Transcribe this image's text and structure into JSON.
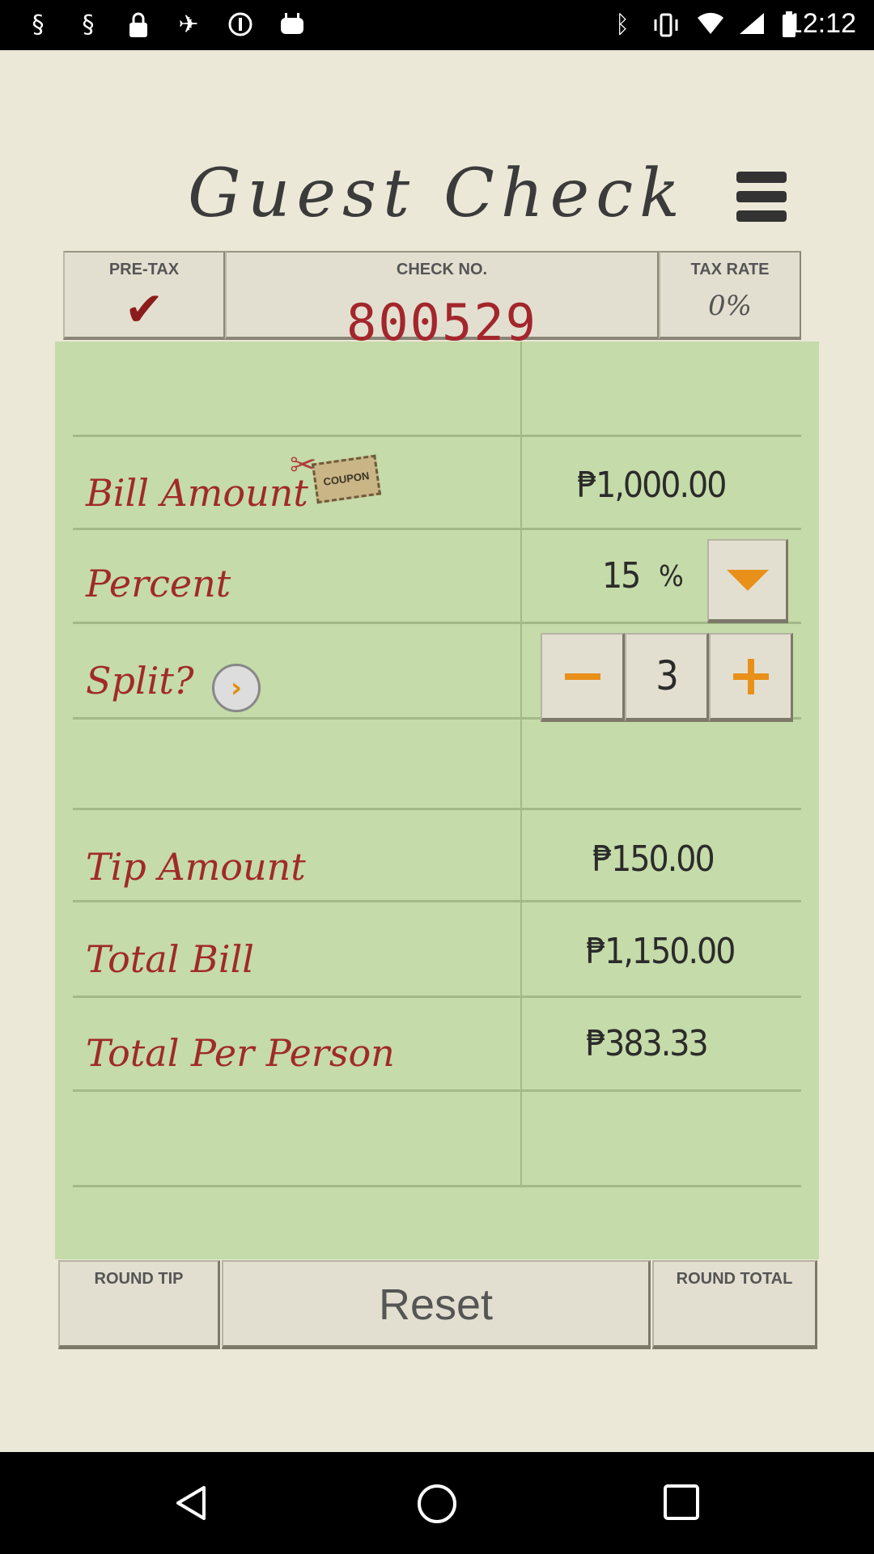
{
  "status_bar": {
    "time": "12:12",
    "icons": [
      "notification-icon",
      "notification-icon",
      "lock-icon",
      "satellite-icon",
      "info-icon",
      "android-icon",
      "bluetooth-icon",
      "vibrate-icon",
      "wifi-icon",
      "signal-icon",
      "battery-icon"
    ]
  },
  "app": {
    "title": "Guest Check",
    "header": {
      "pretax_label": "PRE-TAX",
      "pretax_checked": true,
      "check_no_label": "CHECK NO.",
      "check_no": "800529",
      "tax_rate_label": "TAX RATE",
      "tax_rate": "0%"
    },
    "rows": {
      "bill_amount_label": "Bill Amount",
      "bill_amount": "₱1,000.00",
      "coupon_label": "COUPON",
      "percent_label": "Percent",
      "percent_value": "15",
      "percent_sign": "%",
      "split_label": "Split?",
      "split_count": "3",
      "tip_label": "Tip Amount",
      "tip_amount": "₱150.00",
      "total_label": "Total Bill",
      "total_bill": "₱1,150.00",
      "per_person_label": "Total Per Person",
      "per_person": "₱383.33"
    },
    "buttons": {
      "round_tip": "ROUND TIP",
      "reset": "Reset",
      "round_total": "ROUND TOTAL"
    },
    "colors": {
      "paper": "#ece8d8",
      "sheet": "#c5dba9",
      "ink_red": "#a02a28",
      "accent_orange": "#e8901a"
    }
  }
}
